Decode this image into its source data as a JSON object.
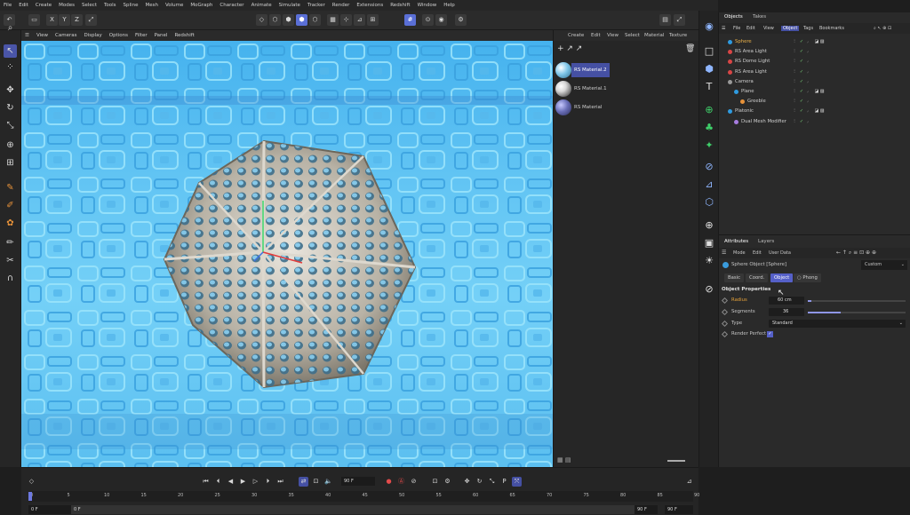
{
  "menubar": [
    "File",
    "Edit",
    "Create",
    "Modes",
    "Select",
    "Tools",
    "Spline",
    "Mesh",
    "Volume",
    "MoGraph",
    "Character",
    "Animate",
    "Simulate",
    "Tracker",
    "Render",
    "Extensions",
    "Redshift",
    "Window",
    "Help"
  ],
  "toolbar": {
    "axis_x": "X",
    "axis_y": "Y",
    "axis_z": "Z"
  },
  "viewport_menu": [
    "View",
    "Cameras",
    "Display",
    "Options",
    "Filter",
    "Panel",
    "Redshift"
  ],
  "material_menu": [
    "Create",
    "Edit",
    "View",
    "Select",
    "Material",
    "Texture"
  ],
  "materials": [
    {
      "name": "RS Material.2",
      "selected": true,
      "color": "#7fc6e8"
    },
    {
      "name": "RS Material.1",
      "selected": false,
      "color": "#d8d8d8"
    },
    {
      "name": "RS Material",
      "selected": false,
      "color": "#6a6fb8"
    }
  ],
  "objects_panel": {
    "tabs": [
      "Objects",
      "Takes"
    ],
    "menu": [
      "File",
      "Edit",
      "View",
      "Object",
      "Tags",
      "Bookmarks"
    ],
    "rows": [
      {
        "name": "Sphere",
        "indent": 0,
        "highlight": true,
        "dot": "#2f9be0"
      },
      {
        "name": "RS Area Light",
        "indent": 0,
        "highlight": false,
        "dot": "#d84646"
      },
      {
        "name": "RS Dome Light",
        "indent": 0,
        "highlight": false,
        "dot": "#d84646"
      },
      {
        "name": "RS Area Light",
        "indent": 0,
        "highlight": false,
        "dot": "#d84646"
      },
      {
        "name": "Camera",
        "indent": 0,
        "highlight": false,
        "dot": "#9a9a9a"
      },
      {
        "name": "Plane",
        "indent": 1,
        "highlight": false,
        "dot": "#2f9be0"
      },
      {
        "name": "Greeble",
        "indent": 2,
        "highlight": false,
        "dot": "#e7923a"
      },
      {
        "name": "Platonic",
        "indent": 0,
        "highlight": false,
        "dot": "#2f9be0"
      },
      {
        "name": "Dual Mesh Modifier",
        "indent": 1,
        "highlight": false,
        "dot": "#a77de0"
      }
    ]
  },
  "attributes_panel": {
    "tabs": [
      "Attributes",
      "Layers"
    ],
    "menu": [
      "Mode",
      "Edit",
      "User Data"
    ],
    "object_title": "Sphere Object [Sphere]",
    "preset": "Custom",
    "subtabs": [
      {
        "label": "Basic",
        "selected": false
      },
      {
        "label": "Coord.",
        "selected": false
      },
      {
        "label": "Object",
        "selected": true
      },
      {
        "label": "Phong",
        "selected": false
      }
    ],
    "section_title": "Object Properties",
    "radius_label": "Radius",
    "radius_value": "60 cm",
    "segments_label": "Segments",
    "segments_value": "36",
    "type_label": "Type",
    "type_value": "Standard",
    "render_perfect_label": "Render Perfect"
  },
  "timeline": {
    "frame_display": "90 F",
    "ruler": [
      "0",
      "5",
      "10",
      "15",
      "20",
      "25",
      "30",
      "35",
      "40",
      "45",
      "50",
      "55",
      "60",
      "65",
      "70",
      "75",
      "80",
      "85",
      "90"
    ],
    "start_frame": "0 F",
    "current_frame": "0 F",
    "end_frame": "90 F",
    "end_frame_2": "90 F"
  }
}
